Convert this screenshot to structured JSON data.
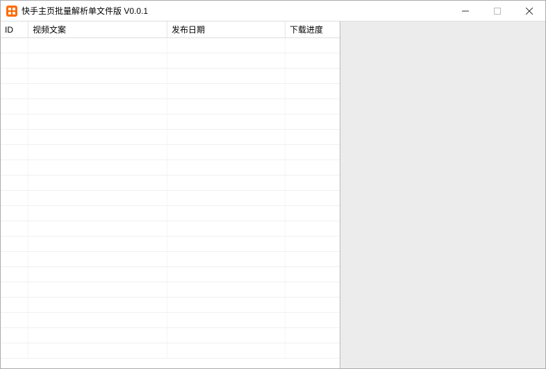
{
  "window": {
    "title": "快手主页批量解析单文件版  V0.0.1"
  },
  "table": {
    "columns": {
      "id": "ID",
      "copy": "视频文案",
      "date": "发布日期",
      "progress": "下载进度"
    },
    "rows": []
  }
}
